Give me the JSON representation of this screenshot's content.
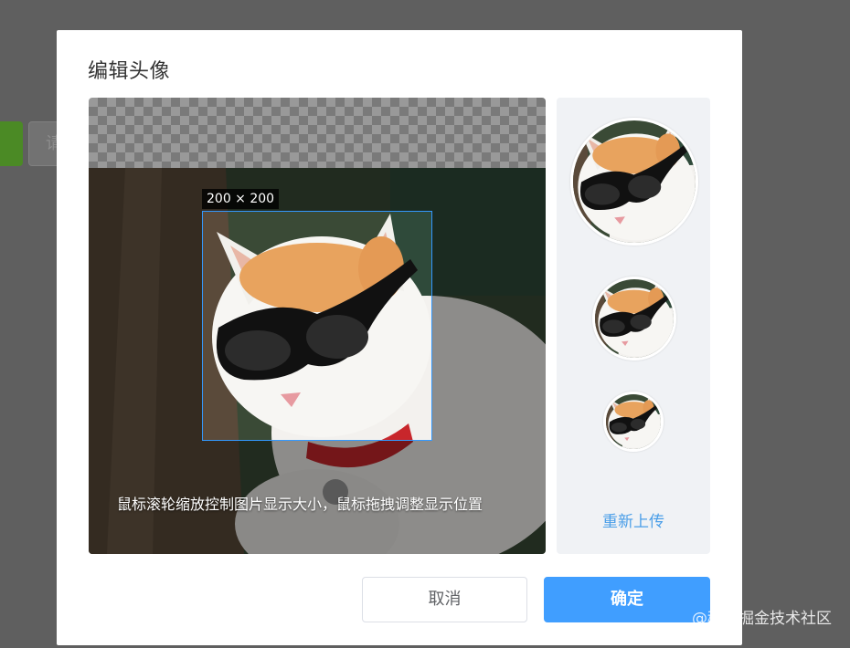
{
  "background": {
    "input_placeholder": "请"
  },
  "dialog": {
    "title": "编辑头像",
    "crop_size_label": "200 × 200",
    "hint": "鼠标滚轮缩放控制图片显示大小，鼠标拖拽调整显示位置",
    "reupload_label": "重新上传",
    "cancel_label": "取消",
    "confirm_label": "确定"
  },
  "watermark": "@稀土掘金技术社区",
  "colors": {
    "primary": "#409eff",
    "link": "#4a9ee8",
    "crop_border": "#3399ff",
    "overlay": "#5f5f5f"
  },
  "icons": {
    "preview_image": "cat-with-sunglasses-photo"
  }
}
